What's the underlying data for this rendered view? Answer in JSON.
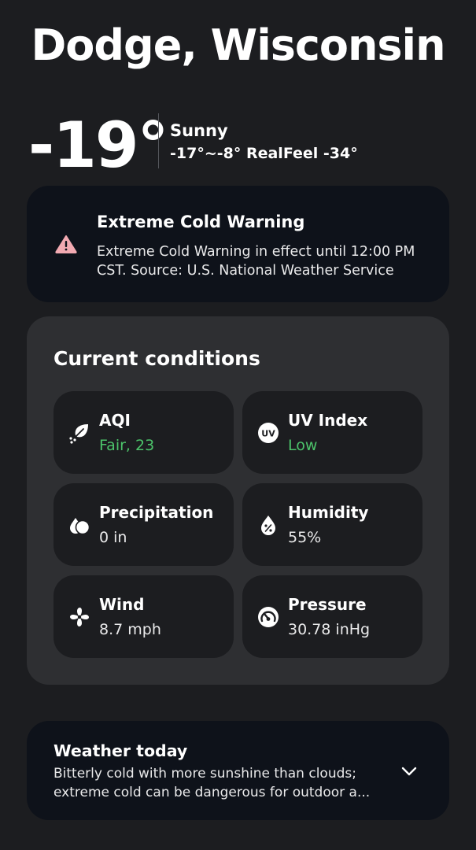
{
  "location": {
    "name": "Dodge, Wisconsin"
  },
  "current": {
    "temperature": "-19°",
    "condition": "Sunny",
    "range_realfeel": "-17°~-8° RealFeel -34°"
  },
  "alert": {
    "icon": "warning-triangle-icon",
    "title": "Extreme Cold Warning",
    "body": "Extreme Cold Warning in effect until 12:00 PM CST.  Source: U.S. National Weather Service"
  },
  "conditions": {
    "heading": "Current conditions",
    "tiles": [
      {
        "label": "AQI",
        "value": "Fair, 23",
        "value_color": "#4cc36a",
        "icon": "leaf-icon"
      },
      {
        "label": "UV Index",
        "value": "Low",
        "value_color": "#4cc36a",
        "icon": "uv-icon"
      },
      {
        "label": "Precipitation",
        "value": "0 in",
        "icon": "raindrop-icon"
      },
      {
        "label": "Humidity",
        "value": "55%",
        "icon": "humidity-icon"
      },
      {
        "label": "Wind",
        "value": "8.7 mph",
        "icon": "fan-icon"
      },
      {
        "label": "Pressure",
        "value": "30.78 inHg",
        "icon": "gauge-icon"
      }
    ]
  },
  "today": {
    "title": "Weather today",
    "body": "Bitterly cold with more sunshine than clouds; extreme cold can be dangerous for outdoor a...",
    "icon": "chevron-down-icon"
  },
  "colors": {
    "background": "#1c1d20",
    "card_dark": "#0e121a",
    "card_gray": "#2e2f32",
    "good_green": "#4cc36a",
    "warning_pink": "#f2aab2"
  }
}
